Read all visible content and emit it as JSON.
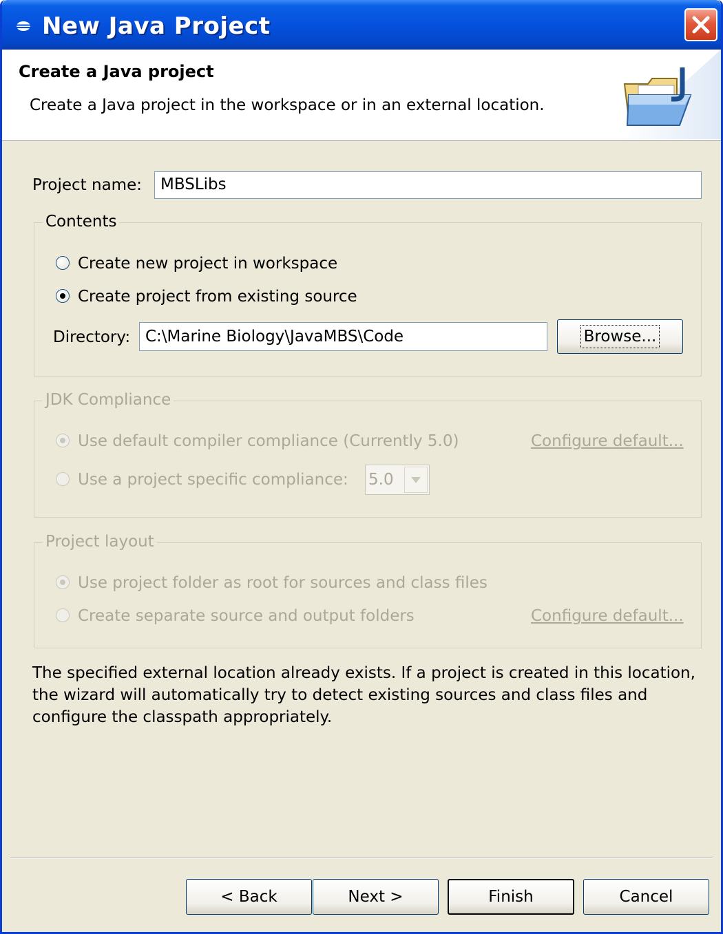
{
  "window": {
    "title": "New Java Project"
  },
  "header": {
    "title": "Create a Java project",
    "description": "Create a Java project in the workspace or in an external location."
  },
  "project_name": {
    "label": "Project name:",
    "value": "MBSLibs"
  },
  "contents": {
    "title": "Contents",
    "option_workspace": "Create new project in workspace",
    "option_existing": "Create project from existing source",
    "selected": "existing",
    "directory_label": "Directory:",
    "directory_value": "C:\\Marine Biology\\JavaMBS\\Code",
    "browse_label": "Browse..."
  },
  "jdk": {
    "title": "JDK Compliance",
    "option_default": "Use default compiler compliance (Currently 5.0)",
    "option_specific": "Use a project specific compliance:",
    "compliance_value": "5.0",
    "configure_link": "Configure default...",
    "selected": "default",
    "enabled": false
  },
  "layout": {
    "title": "Project layout",
    "option_root": "Use project folder as root for sources and class files",
    "option_separate": "Create separate source and output folders",
    "configure_link": "Configure default...",
    "selected": "root",
    "enabled": false
  },
  "status_message": "The specified external location already exists. If a project is created in this location, the wizard will automatically try to detect existing sources and class files and configure the classpath appropriately.",
  "buttons": {
    "back": "< Back",
    "next": "Next >",
    "finish": "Finish",
    "cancel": "Cancel"
  },
  "colors": {
    "titlebar": "#0551dd",
    "dialog_bg": "#ece9d8",
    "disabled_text": "#aca899",
    "close_button": "#e2583c"
  }
}
